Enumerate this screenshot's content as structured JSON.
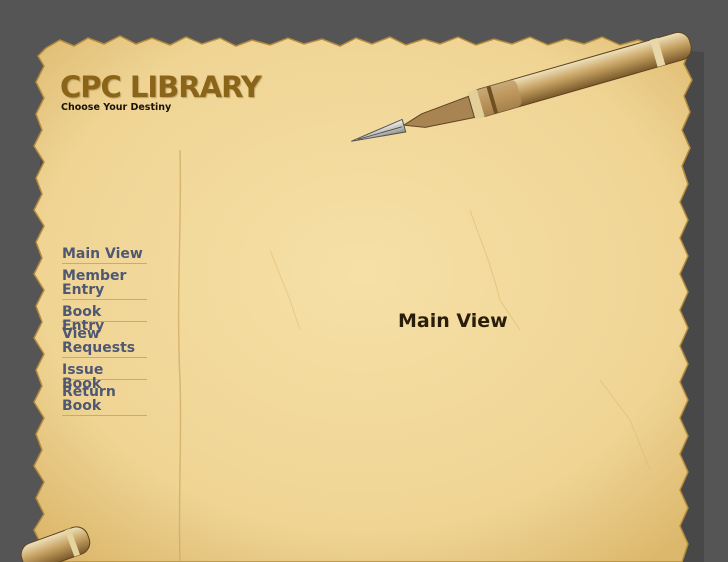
{
  "header": {
    "title": "CPC LIBRARY",
    "tagline": "Choose Your Destiny"
  },
  "nav": {
    "items": [
      {
        "label": "Main View"
      },
      {
        "label": "Member Entry"
      },
      {
        "label": "Book Entry"
      },
      {
        "label": "View Requests"
      },
      {
        "label": "Issue Book"
      },
      {
        "label": "Return Book"
      }
    ]
  },
  "main": {
    "heading": "Main View"
  },
  "decor": {
    "top_image": "fountain-pen",
    "bottom_image": "pen-cap"
  },
  "colors": {
    "background": "#555555",
    "paper": "#f2d99a",
    "title": "#8a6418",
    "nav_link": "#4f5873"
  }
}
